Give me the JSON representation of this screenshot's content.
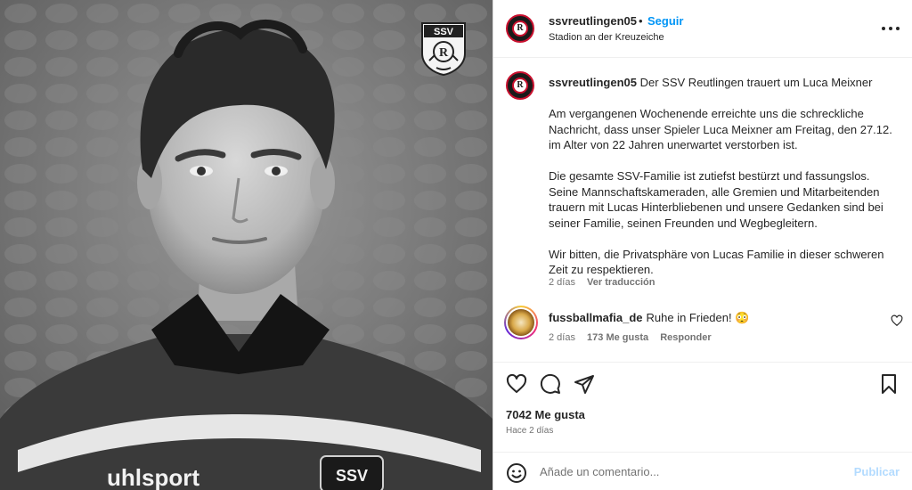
{
  "post": {
    "username": "ssvreutlingen05",
    "follow_sep": "•",
    "follow_label": "Seguir",
    "location": "Stadion an der Kreuzeiche",
    "more_icon": "more-horizontal-icon",
    "avatar_letter": "R"
  },
  "photo": {
    "crest_text": "SSV",
    "crest_letter": "R",
    "shirt_brand": "uhlsport",
    "shirt_badge": "SSV"
  },
  "caption": {
    "username": "ssvreutlingen05",
    "headline": "Der SSV Reutlingen trauert um Luca Meixner",
    "paragraphs": [
      "Am vergangenen Wochenende erreichte uns die schreckliche Nachricht, dass unser Spieler Luca Meixner am Freitag, den 27.12. im Alter von 22 Jahren unerwartet verstorben ist.",
      "Die gesamte SSV-Familie ist zutiefst bestürzt und fassungslos. Seine Mannschaftskameraden, alle Gremien und Mitarbeitenden trauern mit Lucas Hinterbliebenen und unsere Gedanken sind bei seiner Familie, seinen Freunden und Wegbegleitern.",
      "Wir bitten, die Privatsphäre von Lucas Familie in dieser schweren Zeit zu respektieren."
    ],
    "time": "2 días",
    "translate": "Ver traducción"
  },
  "comment": {
    "username": "fussballmafia_de",
    "text": "Ruhe in Frieden! 😳",
    "time": "2 días",
    "likes": "173 Me gusta",
    "reply": "Responder",
    "heart_icon": "heart-outline-icon"
  },
  "actions": {
    "icons": [
      "heart-icon",
      "comment-icon",
      "share-icon",
      "bookmark-icon"
    ],
    "likes": "7042 Me gusta",
    "ago": "Hace 2 días"
  },
  "add_comment": {
    "placeholder": "Añade un comentario...",
    "publish": "Publicar",
    "emoji_icon": "emoji-icon"
  },
  "colors": {
    "link_blue": "#0095f6",
    "publish_disabled": "#b3dbff",
    "muted": "#737373",
    "text": "#262626",
    "club_red": "#c8102e"
  }
}
